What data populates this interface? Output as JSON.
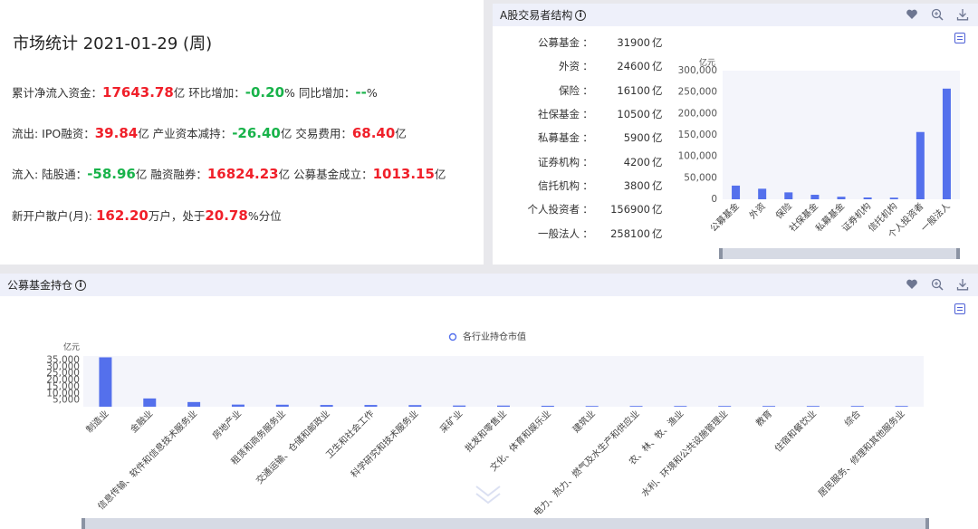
{
  "stats": {
    "title": "市场统计 2021-01-29 (周)",
    "line1": {
      "label1": "累计净流入资金：",
      "value1": "17643.78",
      "unit1": "亿 环比增加：",
      "value2": "-0.20",
      "unit2": "% 同比增加：",
      "value3": "--",
      "unit3": "%"
    },
    "line2": {
      "label1": "流出: IPO融资：",
      "value1": "39.84",
      "unit1": "亿 产业资本减持：",
      "value2": "-26.40",
      "unit2": "亿 交易费用：",
      "value3": "68.40",
      "unit3": "亿"
    },
    "line3": {
      "label1": "流入: 陆股通：",
      "value1": "-58.96",
      "unit1": "亿 融资融券：",
      "value2": "16824.23",
      "unit2": "亿 公募基金成立：",
      "value3": "1013.15",
      "unit3": "亿"
    },
    "line4": {
      "label1": "新开户散户(月): ",
      "value1": "162.20",
      "unit1": "万户，处于",
      "value2": "20.78",
      "unit2": "%分位"
    }
  },
  "ashare": {
    "title": "A股交易者结构",
    "icons": [
      "heart-icon",
      "zoom-icon",
      "download-icon",
      "menu-icon"
    ],
    "colon": "：",
    "unit": "亿",
    "rows": [
      {
        "name": "公募基金",
        "value": "31900"
      },
      {
        "name": "外资",
        "value": "24600"
      },
      {
        "name": "保险",
        "value": "16100"
      },
      {
        "name": "社保基金",
        "value": "10500"
      },
      {
        "name": "私募基金",
        "value": "5900"
      },
      {
        "name": "证券机构",
        "value": "4200"
      },
      {
        "name": "信托机构",
        "value": "3800"
      },
      {
        "name": "个人投资者",
        "value": "156900"
      },
      {
        "name": "一般法人",
        "value": "258100"
      }
    ]
  },
  "fund": {
    "title": "公募基金持仓",
    "icons": [
      "heart-icon",
      "zoom-icon",
      "download-icon",
      "menu-icon"
    ]
  },
  "colors": {
    "bar": "#5470ec",
    "red": "#f0202a",
    "green": "#18b34a",
    "header_bg": "#eef0fa"
  },
  "chart_data": [
    {
      "type": "bar",
      "ylabel": "亿元",
      "ylim": [
        0,
        300000
      ],
      "yticks": [
        "0",
        "50,000",
        "100,000",
        "150,000",
        "200,000",
        "250,000",
        "300,000"
      ],
      "categories": [
        "公募基金",
        "外资",
        "保险",
        "社保基金",
        "私募基金",
        "证券机构",
        "信托机构",
        "个人投资者",
        "一般法人"
      ],
      "values": [
        31900,
        24600,
        16100,
        10500,
        5900,
        4200,
        3800,
        156900,
        258100
      ]
    },
    {
      "type": "bar",
      "ylabel": "亿元",
      "legend": "各行业持仓市值",
      "ylim": [
        0,
        38000
      ],
      "yticks": [
        "5,000",
        "10,000",
        "15,000",
        "20,000",
        "25,000",
        "30,000",
        "35,000"
      ],
      "categories": [
        "制造业",
        "金融业",
        "信息传输、软件和信息技术服务业",
        "房地产业",
        "租赁和商务服务业",
        "交通运输、仓储和邮政业",
        "卫生和社会工作",
        "科学研究和技术服务业",
        "采矿业",
        "批发和零售业",
        "文化、体育和娱乐业",
        "建筑业",
        "电力、热力、燃气及水生产和供应业",
        "农、林、牧、渔业",
        "水利、环境和公共设施管理业",
        "教育",
        "住宿和餐饮业",
        "综合",
        "居民服务、修理和其他服务业"
      ],
      "values": [
        37000,
        6200,
        3500,
        1600,
        1500,
        1300,
        1300,
        1200,
        900,
        850,
        700,
        500,
        300,
        250,
        200,
        100,
        50,
        30,
        10
      ]
    }
  ]
}
